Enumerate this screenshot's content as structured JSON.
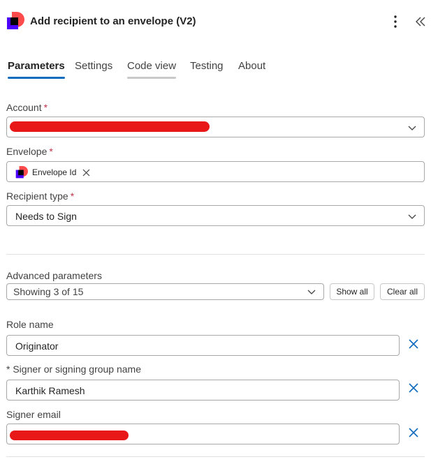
{
  "header": {
    "title": "Add recipient to an envelope (V2)",
    "logo_icon": "docusign-logo-icon",
    "more_icon": "more-vertical-icon",
    "collapse_icon": "double-chevron-left-icon"
  },
  "tabs": [
    {
      "label": "Parameters",
      "state": "active"
    },
    {
      "label": "Settings",
      "state": "normal"
    },
    {
      "label": "Code view",
      "state": "hover"
    },
    {
      "label": "Testing",
      "state": "normal"
    },
    {
      "label": "About",
      "state": "normal"
    }
  ],
  "required_marker": "*",
  "fields": {
    "account": {
      "label": "Account",
      "value_redacted": true
    },
    "envelope": {
      "label": "Envelope",
      "token_label": "Envelope Id"
    },
    "recipient_type": {
      "label": "Recipient type",
      "value": "Needs to Sign"
    }
  },
  "advanced": {
    "label": "Advanced parameters",
    "showing": "Showing 3 of 15",
    "show_all_label": "Show all",
    "clear_all_label": "Clear all"
  },
  "advanced_fields": {
    "role_name": {
      "label": "Role name",
      "value": "Originator"
    },
    "signer_name": {
      "label": "* Signer or signing group name",
      "value": "Karthik Ramesh"
    },
    "signer_email": {
      "label": "Signer email",
      "value_redacted": true
    }
  },
  "colors": {
    "accent": "#0f6cbd",
    "required": "#c4314b",
    "redaction": "#e81818"
  }
}
